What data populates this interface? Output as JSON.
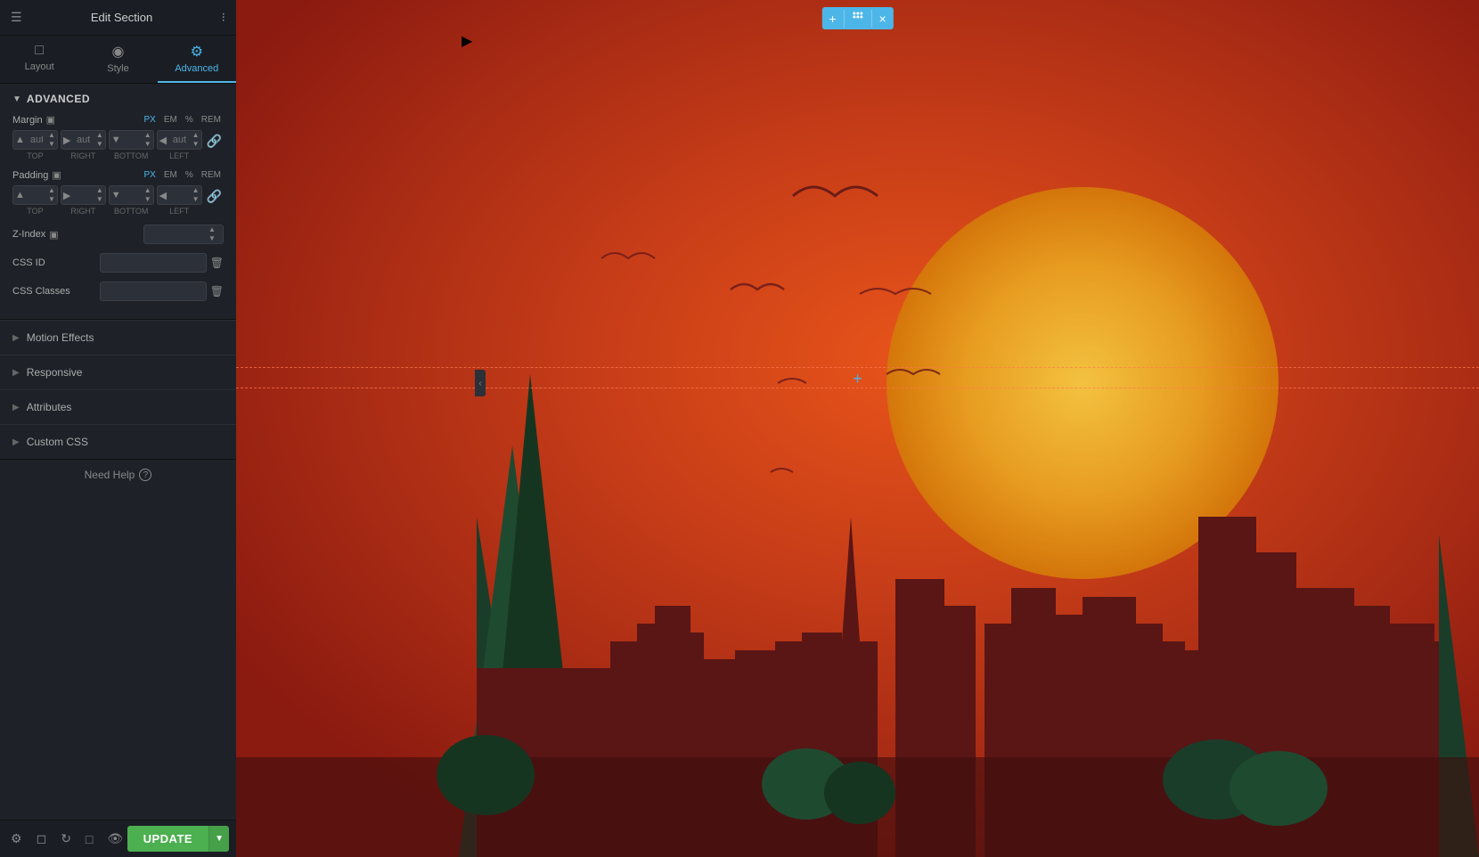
{
  "sidebar": {
    "header": {
      "title": "Edit Section",
      "menu_icon": "≡",
      "grid_icon": "⊞"
    },
    "tabs": [
      {
        "id": "layout",
        "label": "Layout",
        "icon": "□"
      },
      {
        "id": "style",
        "label": "Style",
        "icon": "◉"
      },
      {
        "id": "advanced",
        "label": "Advanced",
        "icon": "⚙"
      }
    ],
    "active_tab": "advanced",
    "advanced_section": {
      "title": "Advanced",
      "margin": {
        "label": "Margin",
        "units": [
          "PX",
          "EM",
          "%",
          "REM"
        ],
        "active_unit": "PX",
        "top": {
          "value": "",
          "placeholder": "aut",
          "label": "TOP"
        },
        "right": {
          "value": "",
          "placeholder": "aut",
          "label": "RIGHT"
        },
        "bottom": {
          "value": "",
          "placeholder": "",
          "label": "BOTTOM"
        },
        "left": {
          "value": "",
          "placeholder": "aut",
          "label": "LEFT"
        }
      },
      "padding": {
        "label": "Padding",
        "units": [
          "PX",
          "EM",
          "%",
          "REM"
        ],
        "active_unit": "PX",
        "top": {
          "value": "",
          "placeholder": "",
          "label": "TOP"
        },
        "right": {
          "value": "",
          "placeholder": "",
          "label": "RIGHT"
        },
        "bottom": {
          "value": "",
          "placeholder": "",
          "label": "BOTTOM"
        },
        "left": {
          "value": "",
          "placeholder": "",
          "label": "LEFT"
        }
      },
      "z_index": {
        "label": "Z-Index",
        "value": ""
      },
      "css_id": {
        "label": "CSS ID",
        "value": ""
      },
      "css_classes": {
        "label": "CSS Classes",
        "value": ""
      }
    },
    "collapsible_sections": [
      {
        "id": "motion-effects",
        "label": "Motion Effects"
      },
      {
        "id": "responsive",
        "label": "Responsive"
      },
      {
        "id": "attributes",
        "label": "Attributes"
      },
      {
        "id": "custom-css",
        "label": "Custom CSS"
      }
    ],
    "need_help": "Need Help",
    "footer": {
      "update_label": "UPDATE",
      "icons": [
        "⚙",
        "◧",
        "↩",
        "🖥",
        "👁"
      ]
    }
  },
  "canvas": {
    "section_toolbar": {
      "add_icon": "+",
      "move_icon": "⊕",
      "close_icon": "×"
    }
  }
}
